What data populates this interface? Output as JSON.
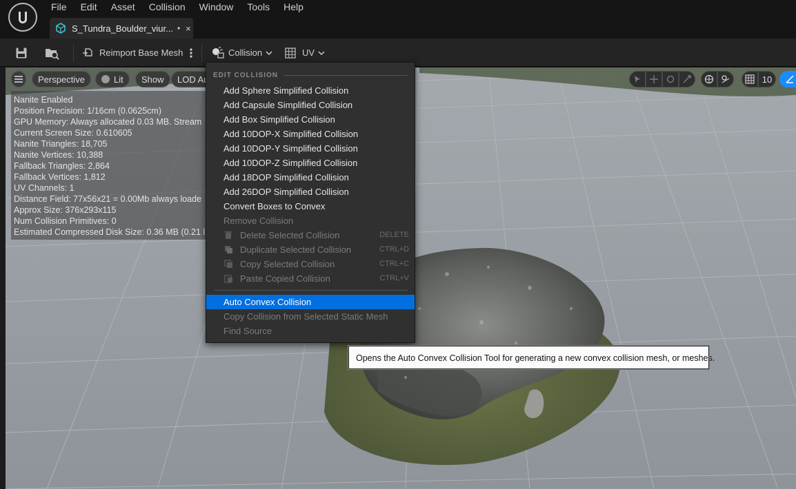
{
  "menu": [
    "File",
    "Edit",
    "Asset",
    "Collision",
    "Window",
    "Tools",
    "Help"
  ],
  "tab": {
    "label": "S_Tundra_Boulder_viur...",
    "modified": "•",
    "close": "×"
  },
  "toolbar": {
    "reimport_label": "Reimport Base Mesh",
    "collision_label": "Collision",
    "uv_label": "UV"
  },
  "viewport": {
    "perspective_label": "Perspective",
    "lit_label": "Lit",
    "show_label": "Show",
    "lod_label": "LOD Au",
    "grid_snap_value": "10"
  },
  "info_lines": [
    "Nanite Enabled",
    "Position Precision: 1/16cm (0.0625cm)",
    "GPU Memory: Always allocated 0.03 MB. Stream",
    "Current Screen Size: 0.610605",
    "Nanite Triangles: 18,705",
    "Nanite Vertices: 10,388",
    "Fallback Triangles: 2,864",
    "Fallback Vertices: 1,812",
    "UV Channels: 1",
    "Distance Field: 77x56x21 = 0.00Mb always loade",
    "Approx Size: 376x293x115",
    "Num Collision Primitives: 0",
    "Estimated Compressed Disk Size: 0.36 MB (0.21 l"
  ],
  "dropdown": {
    "heading": "EDIT COLLISION",
    "items": [
      {
        "label": "Add Sphere Simplified Collision"
      },
      {
        "label": "Add Capsule Simplified Collision"
      },
      {
        "label": "Add Box Simplified Collision"
      },
      {
        "label": "Add 10DOP-X Simplified Collision"
      },
      {
        "label": "Add 10DOP-Y Simplified Collision"
      },
      {
        "label": "Add 10DOP-Z Simplified Collision"
      },
      {
        "label": "Add 18DOP Simplified Collision"
      },
      {
        "label": "Add 26DOP Simplified Collision"
      },
      {
        "label": "Convert Boxes to Convex"
      },
      {
        "label": "Remove Collision"
      }
    ],
    "icon_items": [
      {
        "label": "Delete Selected Collision",
        "shortcut": "DELETE"
      },
      {
        "label": "Duplicate Selected Collision",
        "shortcut": "CTRL+D"
      },
      {
        "label": "Copy Selected Collision",
        "shortcut": "CTRL+C"
      },
      {
        "label": "Paste Copied Collision",
        "shortcut": "CTRL+V"
      }
    ],
    "bottom_items": [
      {
        "label": "Auto Convex Collision"
      },
      {
        "label": "Copy Collision from Selected Static Mesh"
      },
      {
        "label": "Find Source"
      }
    ]
  },
  "tooltip": "Opens the Auto Convex Collision Tool for generating a new convex collision mesh, or meshes.",
  "colors": {
    "highlight": "#0070e0",
    "accent": "#1a8cff",
    "tab_icon": "#3fc1c9"
  }
}
